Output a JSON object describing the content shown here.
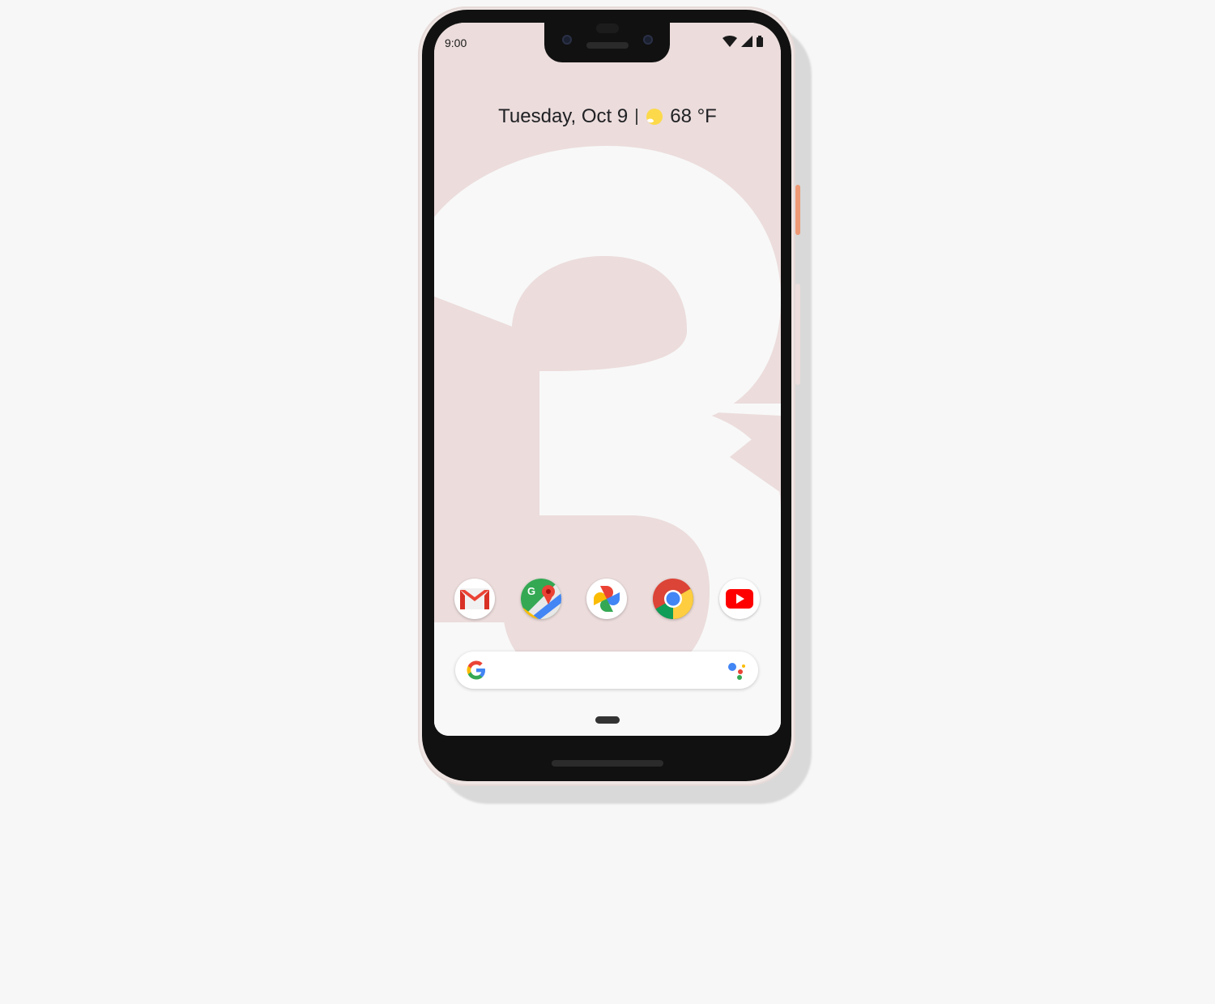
{
  "status_bar": {
    "time": "9:00",
    "icons": [
      "wifi-icon",
      "cell-signal-icon",
      "battery-icon"
    ]
  },
  "at_a_glance": {
    "date": "Tuesday, Oct 9",
    "weather_icon": "sun-icon",
    "temperature": "68 °F"
  },
  "wallpaper": {
    "glyph": "3",
    "colors": {
      "background": "#ecdcdc",
      "numeral": "#f8f8f8"
    }
  },
  "dock": {
    "apps": [
      {
        "name": "Gmail",
        "icon": "gmail-icon"
      },
      {
        "name": "Maps",
        "icon": "maps-icon"
      },
      {
        "name": "Photos",
        "icon": "photos-icon"
      },
      {
        "name": "Chrome",
        "icon": "chrome-icon"
      },
      {
        "name": "YouTube",
        "icon": "youtube-icon"
      }
    ]
  },
  "search_bar": {
    "logo": "google-g-icon",
    "assistant": "assistant-icon"
  },
  "colors": {
    "phone_frame": "#efe5e3",
    "power_button": "#ee9a76",
    "google_blue": "#4285f4",
    "google_red": "#ea4335",
    "google_yellow": "#fbbc05",
    "google_green": "#34a853"
  }
}
